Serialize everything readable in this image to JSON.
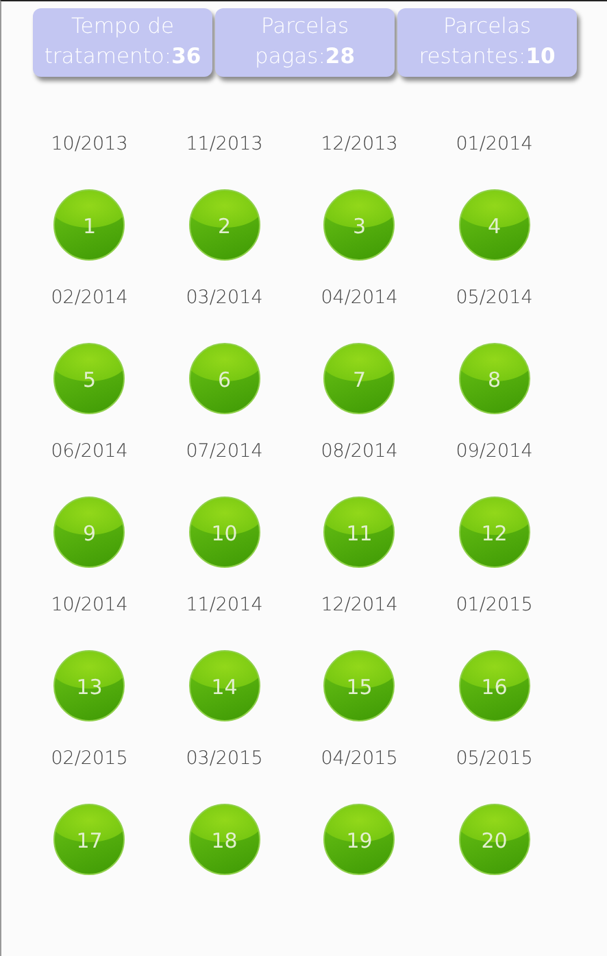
{
  "summary": [
    {
      "label": "Tempo de tratamento:",
      "value": "36"
    },
    {
      "label": "Parcelas pagas:",
      "value": "28"
    },
    {
      "label": "Parcelas restantes:",
      "value": "10"
    }
  ],
  "installments": [
    {
      "date": "10/2013",
      "number": "1",
      "paid": true
    },
    {
      "date": "11/2013",
      "number": "2",
      "paid": true
    },
    {
      "date": "12/2013",
      "number": "3",
      "paid": true
    },
    {
      "date": "01/2014",
      "number": "4",
      "paid": true
    },
    {
      "date": "02/2014",
      "number": "5",
      "paid": true
    },
    {
      "date": "03/2014",
      "number": "6",
      "paid": true
    },
    {
      "date": "04/2014",
      "number": "7",
      "paid": true
    },
    {
      "date": "05/2014",
      "number": "8",
      "paid": true
    },
    {
      "date": "06/2014",
      "number": "9",
      "paid": true
    },
    {
      "date": "07/2014",
      "number": "10",
      "paid": true
    },
    {
      "date": "08/2014",
      "number": "11",
      "paid": true
    },
    {
      "date": "09/2014",
      "number": "12",
      "paid": true
    },
    {
      "date": "10/2014",
      "number": "13",
      "paid": true
    },
    {
      "date": "11/2014",
      "number": "14",
      "paid": true
    },
    {
      "date": "12/2014",
      "number": "15",
      "paid": true
    },
    {
      "date": "01/2015",
      "number": "16",
      "paid": true
    },
    {
      "date": "02/2015",
      "number": "17",
      "paid": true
    },
    {
      "date": "03/2015",
      "number": "18",
      "paid": true
    },
    {
      "date": "04/2015",
      "number": "19",
      "paid": true
    },
    {
      "date": "05/2015",
      "number": "20",
      "paid": true
    }
  ]
}
